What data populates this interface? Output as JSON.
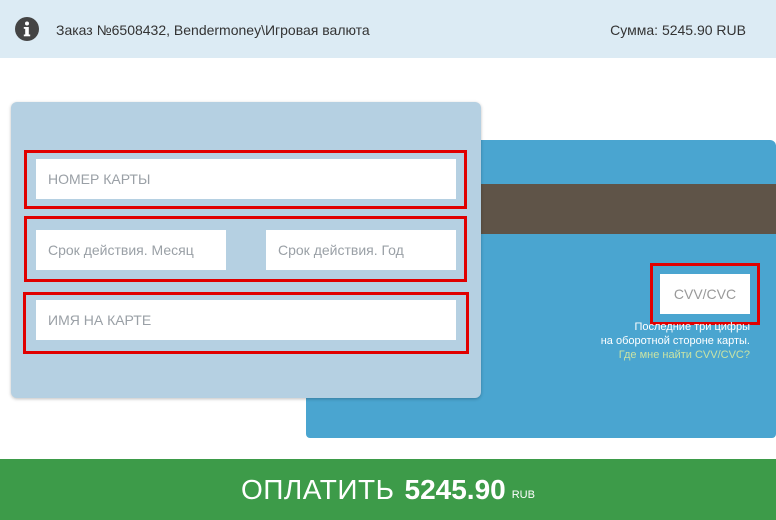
{
  "order": {
    "info_icon": "info-icon",
    "description": "Заказ №6508432, Bendermoney\\Игровая валюта",
    "amount_label": "Сумма: 5245.90 RUB"
  },
  "form": {
    "card_number_placeholder": "НОМЕР КАРТЫ",
    "expiry_month_placeholder": "Срок действия. Месяц",
    "expiry_year_placeholder": "Срок действия. Год",
    "cardholder_placeholder": "ИМЯ НА КАРТЕ"
  },
  "card_back": {
    "cvv_placeholder": "CVV/CVC",
    "hint_line1": "Последние три цифры",
    "hint_line2": "на оборотной стороне карты.",
    "help_link": "Где мне найти CVV/CVC?"
  },
  "pay": {
    "label": "ОПЛАТИТЬ",
    "amount": "5245.90",
    "currency": "RUB"
  },
  "colors": {
    "header_bg": "#dcebf4",
    "card_front": "#b5d0e2",
    "card_back": "#4aa5d0",
    "stripe": "#5f5448",
    "pay_button": "#3d9b49",
    "highlight": "#e00000"
  }
}
